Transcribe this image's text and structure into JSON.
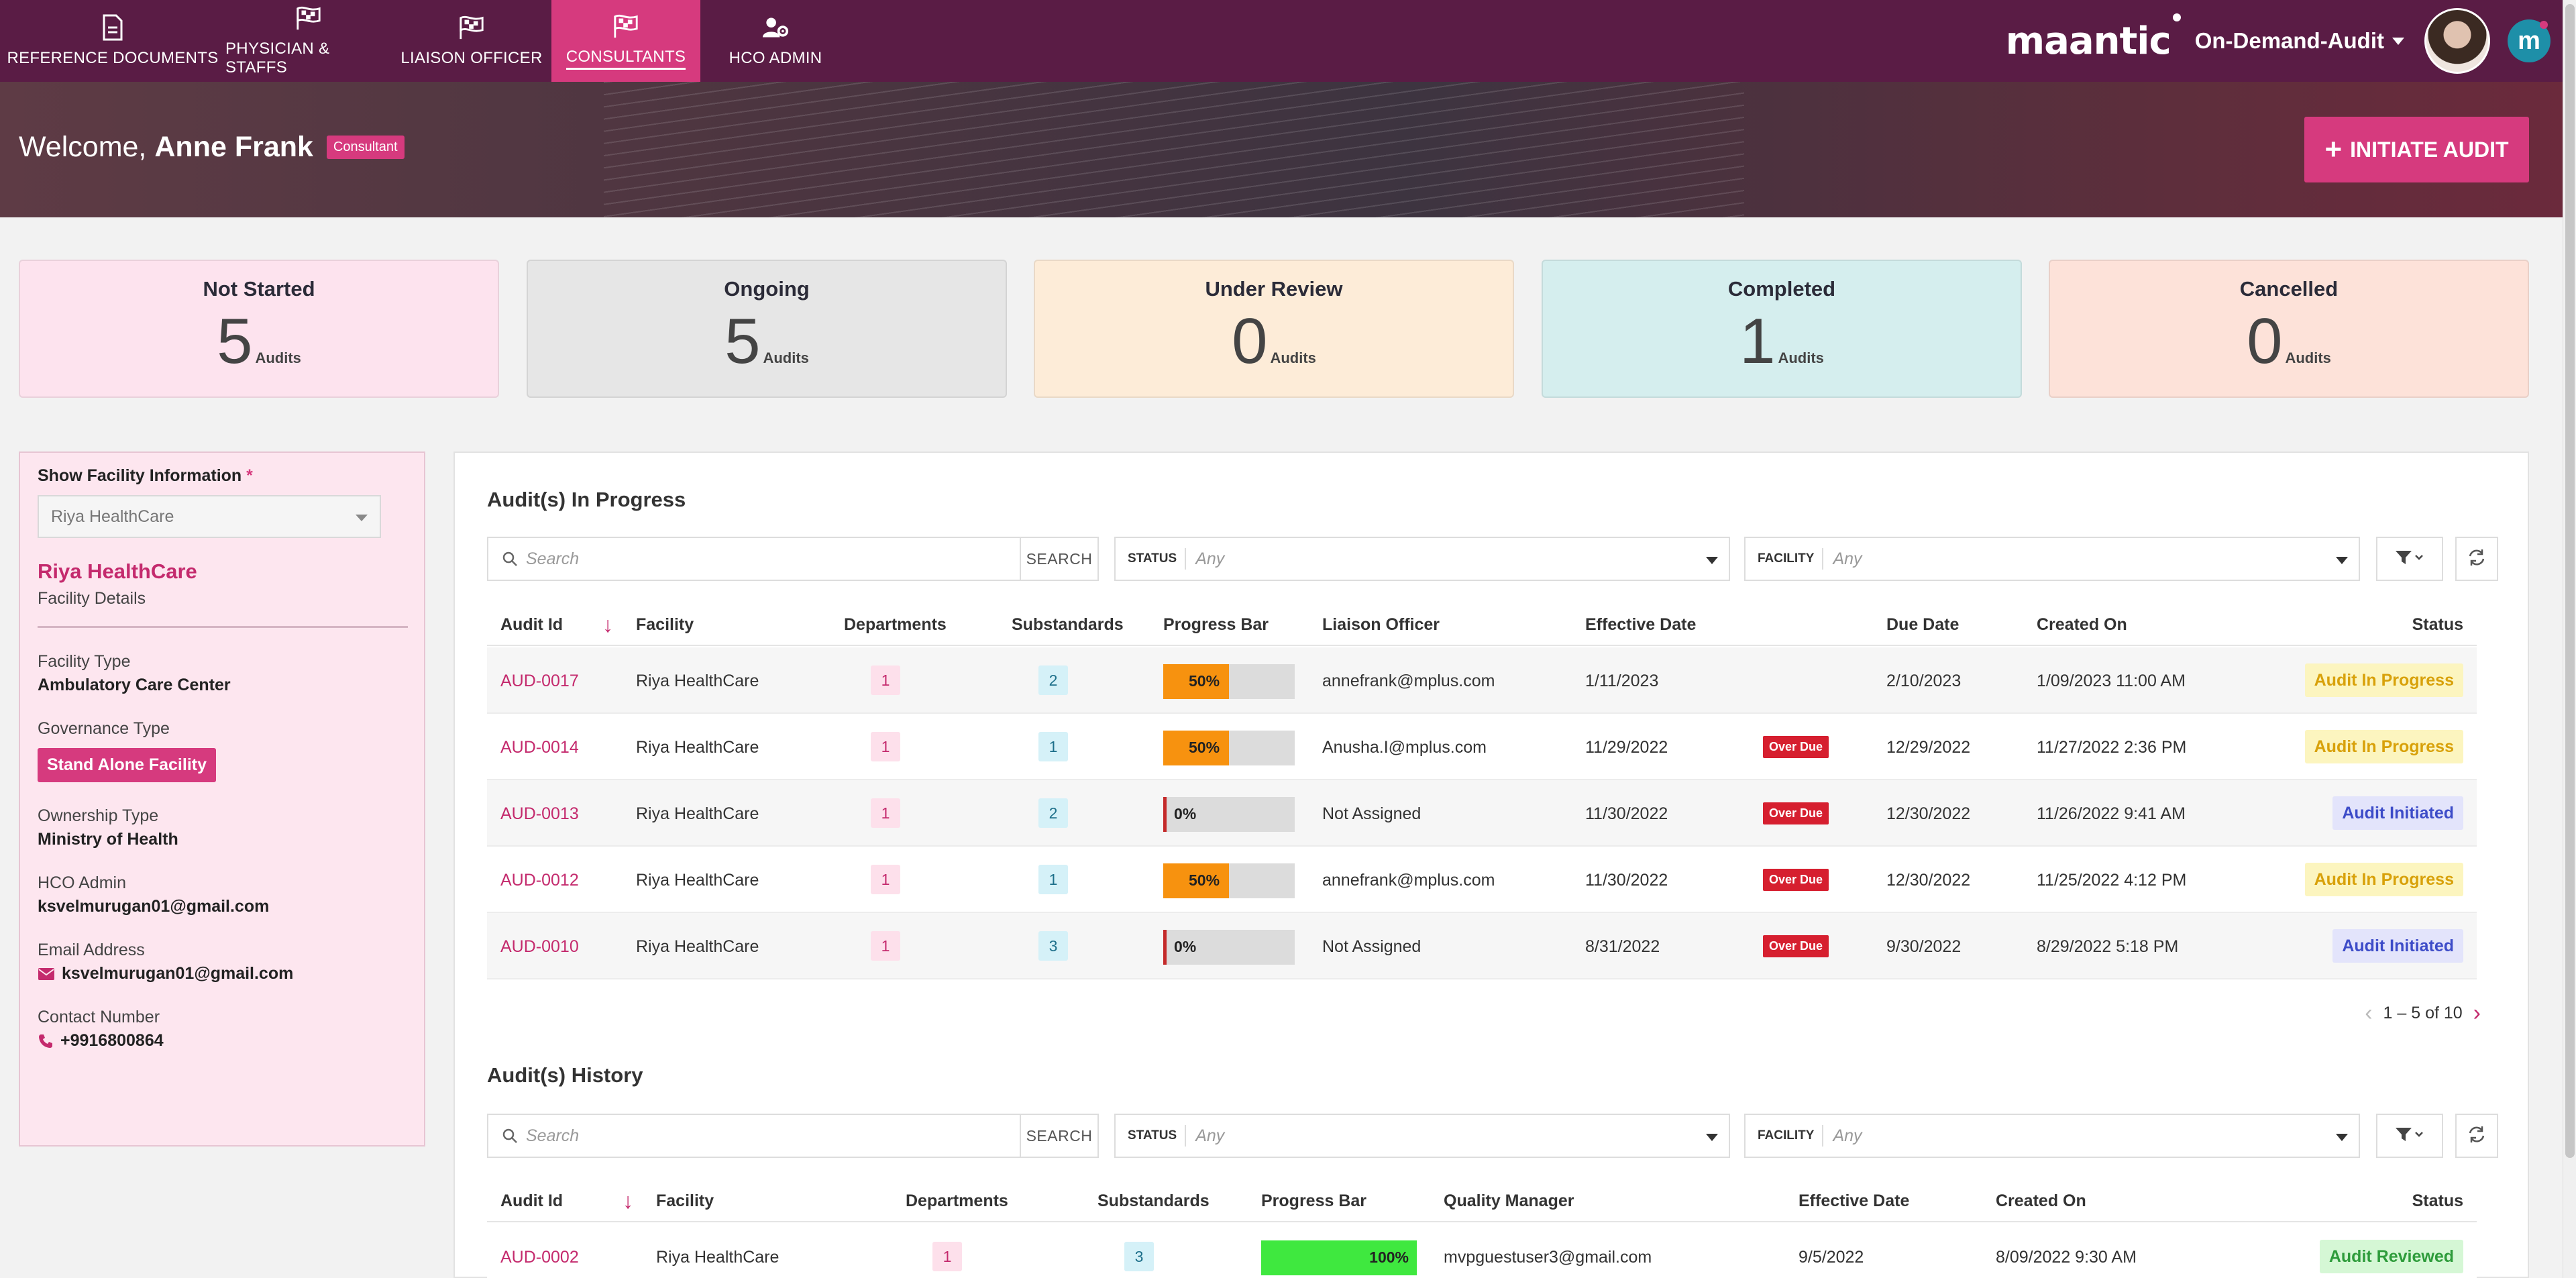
{
  "nav": {
    "items": [
      {
        "label": "REFERENCE DOCUMENTS",
        "icon": "document-icon"
      },
      {
        "label": "PHYSICIAN & STAFFS",
        "icon": "checkered-flag-icon"
      },
      {
        "label": "LIAISON OFFICER",
        "icon": "checkered-flag-icon"
      },
      {
        "label": "CONSULTANTS",
        "icon": "checkered-flag-icon",
        "active": true
      },
      {
        "label": "HCO ADMIN",
        "icon": "user-gear-icon"
      }
    ],
    "brand": "maantic",
    "app_selector": "On-Demand-Audit",
    "colors": {
      "bar": "#5a1c45",
      "active": "#d63a7e"
    }
  },
  "hero": {
    "welcome": "Welcome,",
    "user_name": "Anne Frank",
    "role_badge": "Consultant",
    "initiate_button": "INITIATE AUDIT"
  },
  "status_cards": [
    {
      "title": "Not Started",
      "count": "5",
      "unit": "Audits",
      "color": "#fde3ee"
    },
    {
      "title": "Ongoing",
      "count": "5",
      "unit": "Audits",
      "color": "#e6e6e6"
    },
    {
      "title": "Under Review",
      "count": "0",
      "unit": "Audits",
      "color": "#fdecd8"
    },
    {
      "title": "Completed",
      "count": "1",
      "unit": "Audits",
      "color": "#d5eeee"
    },
    {
      "title": "Cancelled",
      "count": "0",
      "unit": "Audits",
      "color": "#fde2d9"
    }
  ],
  "facility": {
    "show_label": "Show Facility Information",
    "required_mark": "*",
    "selected": "Riya HealthCare",
    "name": "Riya HealthCare",
    "details_label": "Facility Details",
    "type_label": "Facility Type",
    "type_value": "Ambulatory Care Center",
    "governance_label": "Governance Type",
    "governance_value": "Stand Alone Facility",
    "ownership_label": "Ownership Type",
    "ownership_value": "Ministry of Health",
    "admin_label": "HCO Admin",
    "admin_value": "ksvelmurugan01@gmail.com",
    "email_label": "Email Address",
    "email_value": "ksvelmurugan01@gmail.com",
    "phone_label": "Contact Number",
    "phone_value": "+9916800864"
  },
  "in_progress": {
    "title": "Audit(s) In Progress",
    "search_placeholder": "Search",
    "search_button": "SEARCH",
    "status_label": "STATUS",
    "status_value": "Any",
    "facility_label": "FACILITY",
    "facility_value": "Any",
    "columns": [
      "Audit Id",
      "Facility",
      "Departments",
      "Substandards",
      "Progress Bar",
      "Liaison Officer",
      "Effective Date",
      "Due Date",
      "Created On",
      "Status"
    ],
    "rows": [
      {
        "id": "AUD-0017",
        "facility": "Riya HealthCare",
        "departments": "1",
        "substandards": "2",
        "progress": 50,
        "progress_label": "50%",
        "officer": "annefrank@mplus.com",
        "effective": "1/11/2023",
        "overdue": "",
        "due": "2/10/2023",
        "created": "1/09/2023 11:00 AM",
        "status": "Audit In Progress",
        "status_kind": "inprog"
      },
      {
        "id": "AUD-0014",
        "facility": "Riya HealthCare",
        "departments": "1",
        "substandards": "1",
        "progress": 50,
        "progress_label": "50%",
        "officer": "Anusha.I@mplus.com",
        "effective": "11/29/2022",
        "overdue": "Over Due",
        "due": "12/29/2022",
        "created": "11/27/2022 2:36 PM",
        "status": "Audit In Progress",
        "status_kind": "inprog"
      },
      {
        "id": "AUD-0013",
        "facility": "Riya HealthCare",
        "departments": "1",
        "substandards": "2",
        "progress": 0,
        "progress_label": "0%",
        "officer": "Not Assigned",
        "effective": "11/30/2022",
        "overdue": "Over Due",
        "due": "12/30/2022",
        "created": "11/26/2022 9:41 AM",
        "status": "Audit Initiated",
        "status_kind": "init"
      },
      {
        "id": "AUD-0012",
        "facility": "Riya HealthCare",
        "departments": "1",
        "substandards": "1",
        "progress": 50,
        "progress_label": "50%",
        "officer": "annefrank@mplus.com",
        "effective": "11/30/2022",
        "overdue": "Over Due",
        "due": "12/30/2022",
        "created": "11/25/2022 4:12 PM",
        "status": "Audit In Progress",
        "status_kind": "inprog"
      },
      {
        "id": "AUD-0010",
        "facility": "Riya HealthCare",
        "departments": "1",
        "substandards": "3",
        "progress": 0,
        "progress_label": "0%",
        "officer": "Not Assigned",
        "effective": "8/31/2022",
        "overdue": "Over Due",
        "due": "9/30/2022",
        "created": "8/29/2022 5:18 PM",
        "status": "Audit Initiated",
        "status_kind": "init"
      }
    ],
    "pager": "1 – 5 of 10"
  },
  "history": {
    "title": "Audit(s) History",
    "search_placeholder": "Search",
    "search_button": "SEARCH",
    "status_label": "STATUS",
    "status_value": "Any",
    "facility_label": "FACILITY",
    "facility_value": "Any",
    "columns": [
      "Audit Id",
      "Facility",
      "Departments",
      "Substandards",
      "Progress Bar",
      "Quality Manager",
      "Effective Date",
      "Created On",
      "Status"
    ],
    "rows": [
      {
        "id": "AUD-0002",
        "facility": "Riya HealthCare",
        "departments": "1",
        "substandards": "3",
        "progress": 100,
        "progress_label": "100%",
        "manager": "mvpguestuser3@gmail.com",
        "effective": "9/5/2022",
        "created": "8/09/2022 9:30 AM",
        "status": "Audit Reviewed",
        "status_kind": "reviewed"
      }
    ]
  }
}
